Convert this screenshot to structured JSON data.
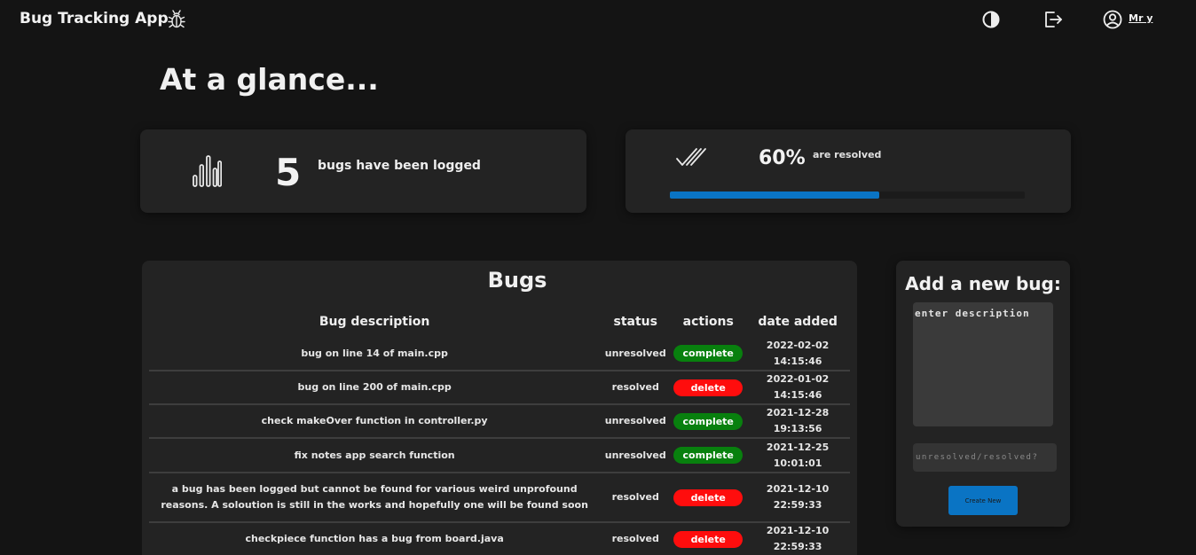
{
  "header": {
    "app_title": "Bug Tracking App",
    "logo_icon": "bug-icon",
    "theme_icon": "contrast-icon",
    "logout_icon": "logout-icon",
    "user_icon": "user-circle-icon",
    "user_name": "Mr y"
  },
  "page_title": "At a glance...",
  "stats": {
    "logged_icon": "bar-chart-icon",
    "logged_count": "5",
    "logged_text": "bugs have been logged",
    "resolved_icon": "double-check-icon",
    "resolved_percent": "60%",
    "resolved_text": "are resolved",
    "resolved_fraction": 0.6
  },
  "bugs": {
    "title": "Bugs",
    "columns": [
      "Bug description",
      "status",
      "actions",
      "date added"
    ],
    "rows": [
      {
        "description": "bug on line 14 of main.cpp",
        "status": "unresolved",
        "action": "complete",
        "date": "2022-02-02 14:15:46"
      },
      {
        "description": "bug on line 200 of main.cpp",
        "status": "resolved",
        "action": "delete",
        "date": "2022-01-02 14:15:46"
      },
      {
        "description": "check makeOver function in controller.py",
        "status": "unresolved",
        "action": "complete",
        "date": "2021-12-28 19:13:56"
      },
      {
        "description": "fix notes app search function",
        "status": "unresolved",
        "action": "complete",
        "date": "2021-12-25 10:01:01"
      },
      {
        "description": "a bug has been logged but cannot be found for various weird unprofound reasons. A soloution is still in the works and hopefully one will be found soon",
        "status": "resolved",
        "action": "delete",
        "date": "2021-12-10 22:59:33"
      },
      {
        "description": "checkpiece function has a bug from board.java",
        "status": "resolved",
        "action": "delete",
        "date": "2021-12-10 22:59:33"
      }
    ]
  },
  "add_bug": {
    "title": "Add a new bug:",
    "description_placeholder": "enter description",
    "status_placeholder": "unresolved/resolved?",
    "button_label": "Create New"
  },
  "colors": {
    "accent": "#0a74c4",
    "complete": "#08800e",
    "delete": "#ff0d0d",
    "background": "#141414",
    "card": "#232323"
  }
}
